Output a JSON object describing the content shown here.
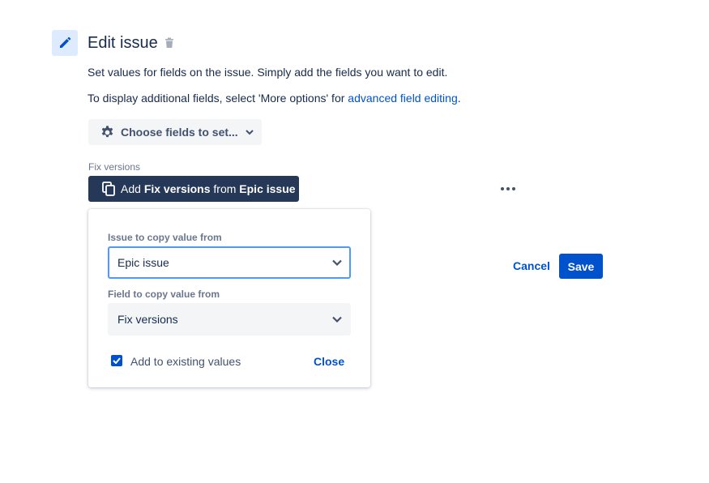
{
  "header": {
    "icon": "pencil-icon",
    "title": "Edit issue",
    "delete_icon": "trash-icon"
  },
  "description": {
    "line1": "Set values for fields on the issue. Simply add the fields you want to edit.",
    "line2_prefix": "To display additional fields, select 'More options' for ",
    "line2_link": "advanced field editing",
    "line2_suffix": "."
  },
  "choose_fields": {
    "label": "Choose fields to set...",
    "icon": "gear-icon"
  },
  "fix_versions": {
    "label": "Fix versions",
    "button_prefix": "Add ",
    "button_field": "Fix versions",
    "button_middle": " from ",
    "button_source": "Epic issue"
  },
  "copy_popup": {
    "issue_label": "Issue to copy value from",
    "issue_value": "Epic issue",
    "field_label": "Field to copy value from",
    "field_value": "Fix versions",
    "add_existing_label": "Add to existing values",
    "add_existing_checked": true,
    "close_label": "Close"
  },
  "actions": {
    "cancel_label": "Cancel",
    "save_label": "Save"
  },
  "colors": {
    "primary": "#0052CC",
    "dark_button": "#253858",
    "text": "#172B4D",
    "subtle_text": "#6B778C",
    "focus_border": "#4C9AFF"
  }
}
